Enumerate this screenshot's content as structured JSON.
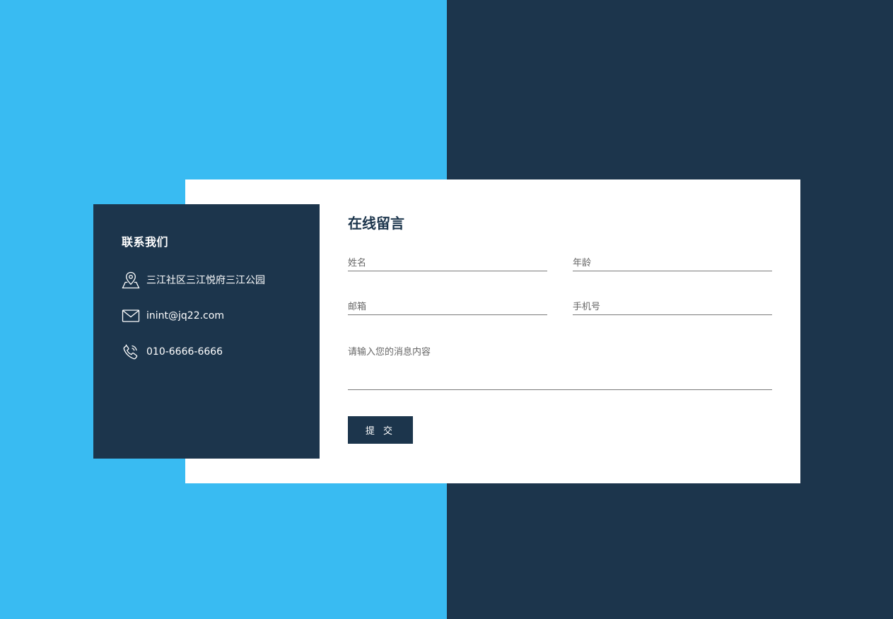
{
  "contact": {
    "title": "联系我们",
    "address": "三江社区三江悦府三江公园",
    "email": "inint@jq22.com",
    "phone": "010-6666-6666",
    "icons": [
      "location-pin-icon",
      "mail-icon",
      "phone-icon"
    ]
  },
  "form": {
    "title": "在线留言",
    "name_placeholder": "姓名",
    "age_placeholder": "年龄",
    "email_placeholder": "邮箱",
    "phone_placeholder": "手机号",
    "message_placeholder": "请输入您的消息内容",
    "submit_label": "提 交"
  },
  "colors": {
    "accent_blue": "#39bbf2",
    "navy": "#1c354c",
    "card": "#ffffff"
  }
}
